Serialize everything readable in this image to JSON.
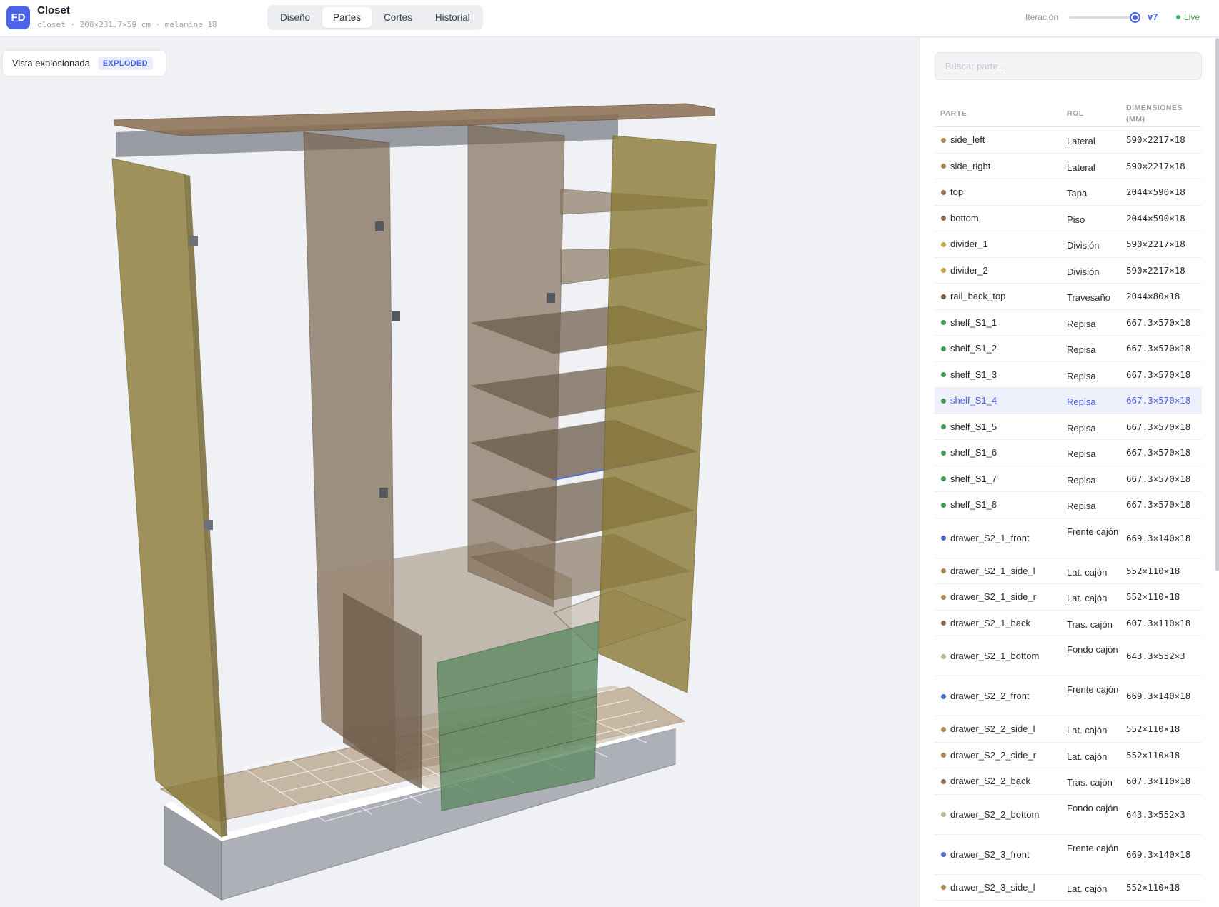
{
  "app": {
    "logo": "FD",
    "title": "Closet",
    "subtitle": "closet · 208×231.7×59 cm · melamine_18"
  },
  "tabs": [
    {
      "label": "Diseño",
      "active": false
    },
    {
      "label": "Partes",
      "active": true
    },
    {
      "label": "Cortes",
      "active": false
    },
    {
      "label": "Historial",
      "active": false
    }
  ],
  "iteration": {
    "label": "Iteración",
    "version": "v7",
    "status": "Live"
  },
  "view": {
    "label": "Vista explosionada",
    "mode": "EXPLODED"
  },
  "panel": {
    "search_placeholder": "Buscar parte…",
    "columns": {
      "part": "PARTE",
      "role": "ROL",
      "dims": "DIMENSIONES (MM)"
    },
    "selected": "shelf_S1_4",
    "rows": [
      {
        "name": "side_left",
        "role": "Lateral",
        "dims": "590×2217×18",
        "color": "#a9884f"
      },
      {
        "name": "side_right",
        "role": "Lateral",
        "dims": "590×2217×18",
        "color": "#a9884f"
      },
      {
        "name": "top",
        "role": "Tapa",
        "dims": "2044×590×18",
        "color": "#8a6e52"
      },
      {
        "name": "bottom",
        "role": "Piso",
        "dims": "2044×590×18",
        "color": "#8a6e52"
      },
      {
        "name": "divider_1",
        "role": "División",
        "dims": "590×2217×18",
        "color": "#c4a547"
      },
      {
        "name": "divider_2",
        "role": "División",
        "dims": "590×2217×18",
        "color": "#c4a547"
      },
      {
        "name": "rail_back_top",
        "role": "Travesaño",
        "dims": "2044×80×18",
        "color": "#7a5d42"
      },
      {
        "name": "shelf_S1_1",
        "role": "Repisa",
        "dims": "667.3×570×18",
        "color": "#3f9a55"
      },
      {
        "name": "shelf_S1_2",
        "role": "Repisa",
        "dims": "667.3×570×18",
        "color": "#3f9a55"
      },
      {
        "name": "shelf_S1_3",
        "role": "Repisa",
        "dims": "667.3×570×18",
        "color": "#3f9a55"
      },
      {
        "name": "shelf_S1_4",
        "role": "Repisa",
        "dims": "667.3×570×18",
        "color": "#3f9a55"
      },
      {
        "name": "shelf_S1_5",
        "role": "Repisa",
        "dims": "667.3×570×18",
        "color": "#3f9a55"
      },
      {
        "name": "shelf_S1_6",
        "role": "Repisa",
        "dims": "667.3×570×18",
        "color": "#3f9a55"
      },
      {
        "name": "shelf_S1_7",
        "role": "Repisa",
        "dims": "667.3×570×18",
        "color": "#3f9a55"
      },
      {
        "name": "shelf_S1_8",
        "role": "Repisa",
        "dims": "667.3×570×18",
        "color": "#3f9a55"
      },
      {
        "name": "drawer_S2_1_front",
        "role": "Frente cajón",
        "dims": "669.3×140×18",
        "color": "#4a6bc7"
      },
      {
        "name": "drawer_S2_1_side_l",
        "role": "Lat. cajón",
        "dims": "552×110×18",
        "color": "#a9884f"
      },
      {
        "name": "drawer_S2_1_side_r",
        "role": "Lat. cajón",
        "dims": "552×110×18",
        "color": "#a9884f"
      },
      {
        "name": "drawer_S2_1_back",
        "role": "Tras. cajón",
        "dims": "607.3×110×18",
        "color": "#8a6e52"
      },
      {
        "name": "drawer_S2_1_bottom",
        "role": "Fondo cajón",
        "dims": "643.3×552×3",
        "color": "#c2b59c"
      },
      {
        "name": "drawer_S2_2_front",
        "role": "Frente cajón",
        "dims": "669.3×140×18",
        "color": "#4a6bc7"
      },
      {
        "name": "drawer_S2_2_side_l",
        "role": "Lat. cajón",
        "dims": "552×110×18",
        "color": "#a9884f"
      },
      {
        "name": "drawer_S2_2_side_r",
        "role": "Lat. cajón",
        "dims": "552×110×18",
        "color": "#a9884f"
      },
      {
        "name": "drawer_S2_2_back",
        "role": "Tras. cajón",
        "dims": "607.3×110×18",
        "color": "#8a6e52"
      },
      {
        "name": "drawer_S2_2_bottom",
        "role": "Fondo cajón",
        "dims": "643.3×552×3",
        "color": "#c2b59c"
      },
      {
        "name": "drawer_S2_3_front",
        "role": "Frente cajón",
        "dims": "669.3×140×18",
        "color": "#4a6bc7"
      },
      {
        "name": "drawer_S2_3_side_l",
        "role": "Lat. cajón",
        "dims": "552×110×18",
        "color": "#a9884f"
      }
    ]
  },
  "colors": {
    "accent": "#4a63e7",
    "live": "#3eb56a",
    "selected_row": "#eef0fc"
  }
}
